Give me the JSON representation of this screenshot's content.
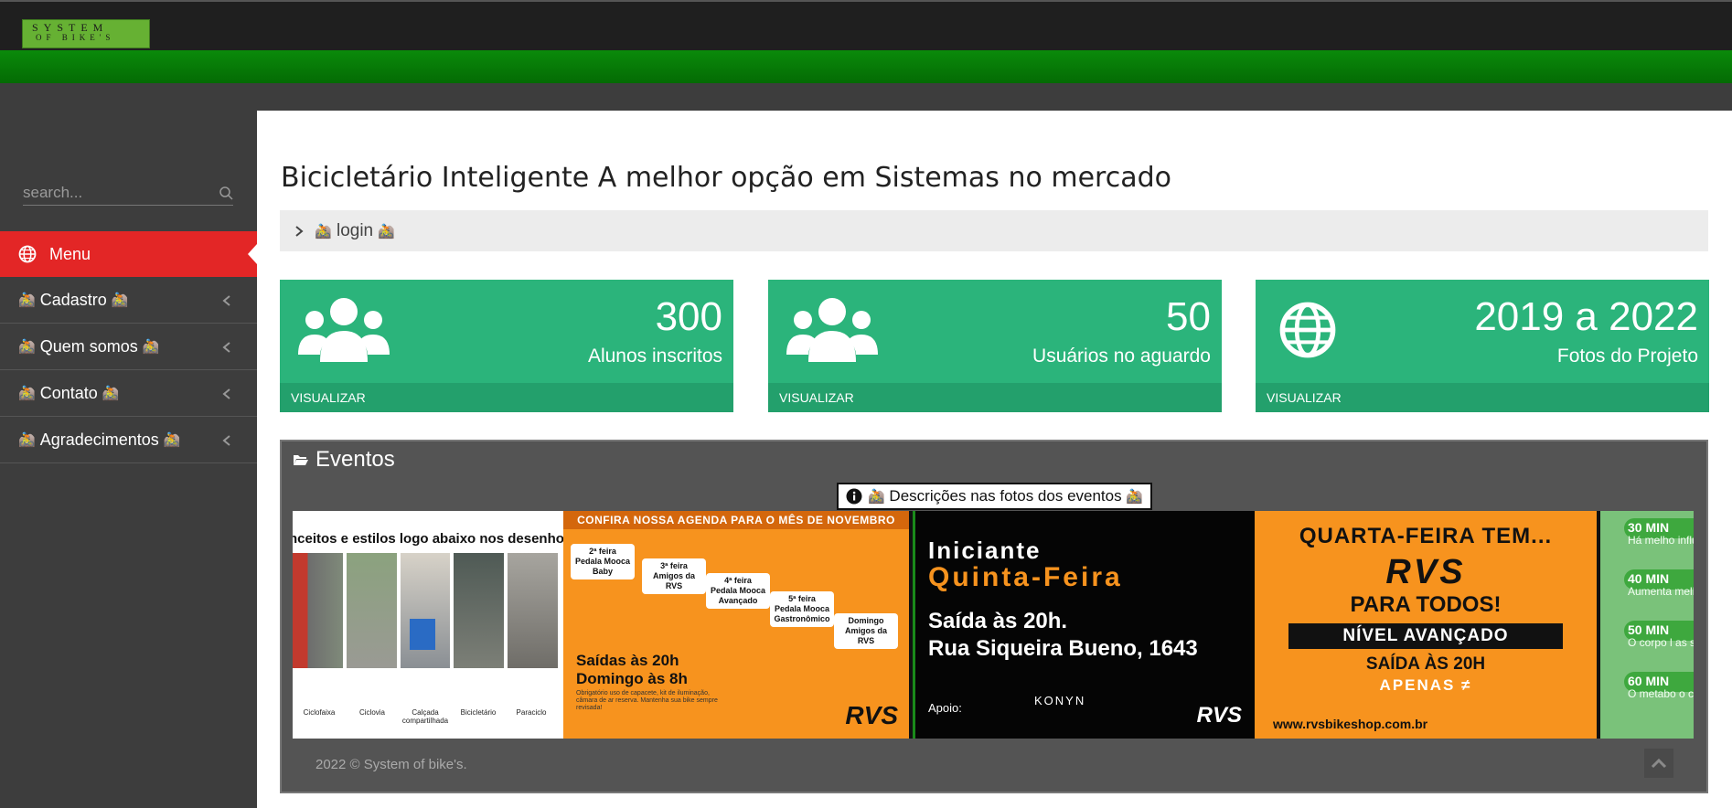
{
  "brand": {
    "logo_line1": "SYSTEM",
    "logo_line2": "OF BIKE'S"
  },
  "sidebar": {
    "search_placeholder": "search...",
    "menu_label": "Menu",
    "items": [
      {
        "label": "Cadastro"
      },
      {
        "label": "Quem somos"
      },
      {
        "label": "Contato"
      },
      {
        "label": "Agradecimentos"
      }
    ],
    "bike_emoji": "🚵"
  },
  "header": {
    "title": "Bicicletário Inteligente A melhor opção em Sistemas no mercado",
    "breadcrumb": "login"
  },
  "cards": [
    {
      "value": "300",
      "label": "Alunos inscritos",
      "link": "VISUALIZAR",
      "icon": "users-icon"
    },
    {
      "value": "50",
      "label": "Usuários no aguardo",
      "link": "VISUALIZAR",
      "icon": "users-icon"
    },
    {
      "value": "2019 a 2022",
      "label": "Fotos do Projeto",
      "link": "VISUALIZAR",
      "icon": "globe-icon"
    }
  ],
  "events": {
    "title": "Eventos",
    "caption": "Descrições nas fotos dos eventos",
    "slide1": {
      "heading": "nceitos e estilos logo abaixo nos desenhos:",
      "captions": [
        "Ciclofaixa",
        "Ciclovia",
        "Calçada compartilhada",
        "Bicicletário",
        "Paraciclo"
      ]
    },
    "slide2": {
      "banner": "CONFIRA NOSSA AGENDA PARA O MÊS DE NOVEMBRO",
      "tags": [
        {
          "day": "2ª feira",
          "name": "Pedala Mooca Baby"
        },
        {
          "day": "3ª feira",
          "name": "Amigos da RVS"
        },
        {
          "day": "4ª feira",
          "name": "Pedala Mooca Avançado"
        },
        {
          "day": "5ª feira",
          "name": "Pedala Mooca Gastronômico"
        },
        {
          "day": "Domingo",
          "name": "Amigos da RVS"
        }
      ],
      "times_line1": "Saídas às 20h",
      "times_line2": "Domingo às 8h",
      "note": "Obrigatório uso de capacete, kit de iluminação, câmara de ar reserva. Mantenha sua bike sempre revisada!",
      "brand": "RVS"
    },
    "slide3": {
      "line1": "Iniciante",
      "line2": "Quinta-Feira",
      "line3": "Saída às 20h.",
      "line4": "Rua Siqueira Bueno, 1643",
      "support": "Apoio:",
      "sponsor": "KONYN",
      "brand": "RVS"
    },
    "slide4": {
      "line1": "QUARTA-FEIRA TEM...",
      "line2": "RVS",
      "line3": "PARA TODOS!",
      "line4": "NÍVEL AVANÇADO",
      "line5": "SAÍDA ÀS 20H",
      "line6": "APENAS ≠",
      "site": "www.rvsbikeshop.com.br"
    },
    "slide5": {
      "rows": [
        {
          "head": "30 MIN",
          "text": "Há melho influencia"
        },
        {
          "head": "40 MIN",
          "text": "Aumenta melhora d"
        },
        {
          "head": "50 MIN",
          "text": "O corpo l as substâ"
        },
        {
          "head": "60 MIN",
          "text": "O metabo o controle"
        }
      ]
    }
  },
  "footer": {
    "copyright": "2022 © System of bike's."
  },
  "colors": {
    "accent_red": "#e32626",
    "card_green": "#2bb47b",
    "top_green": "#0a8a0a"
  }
}
